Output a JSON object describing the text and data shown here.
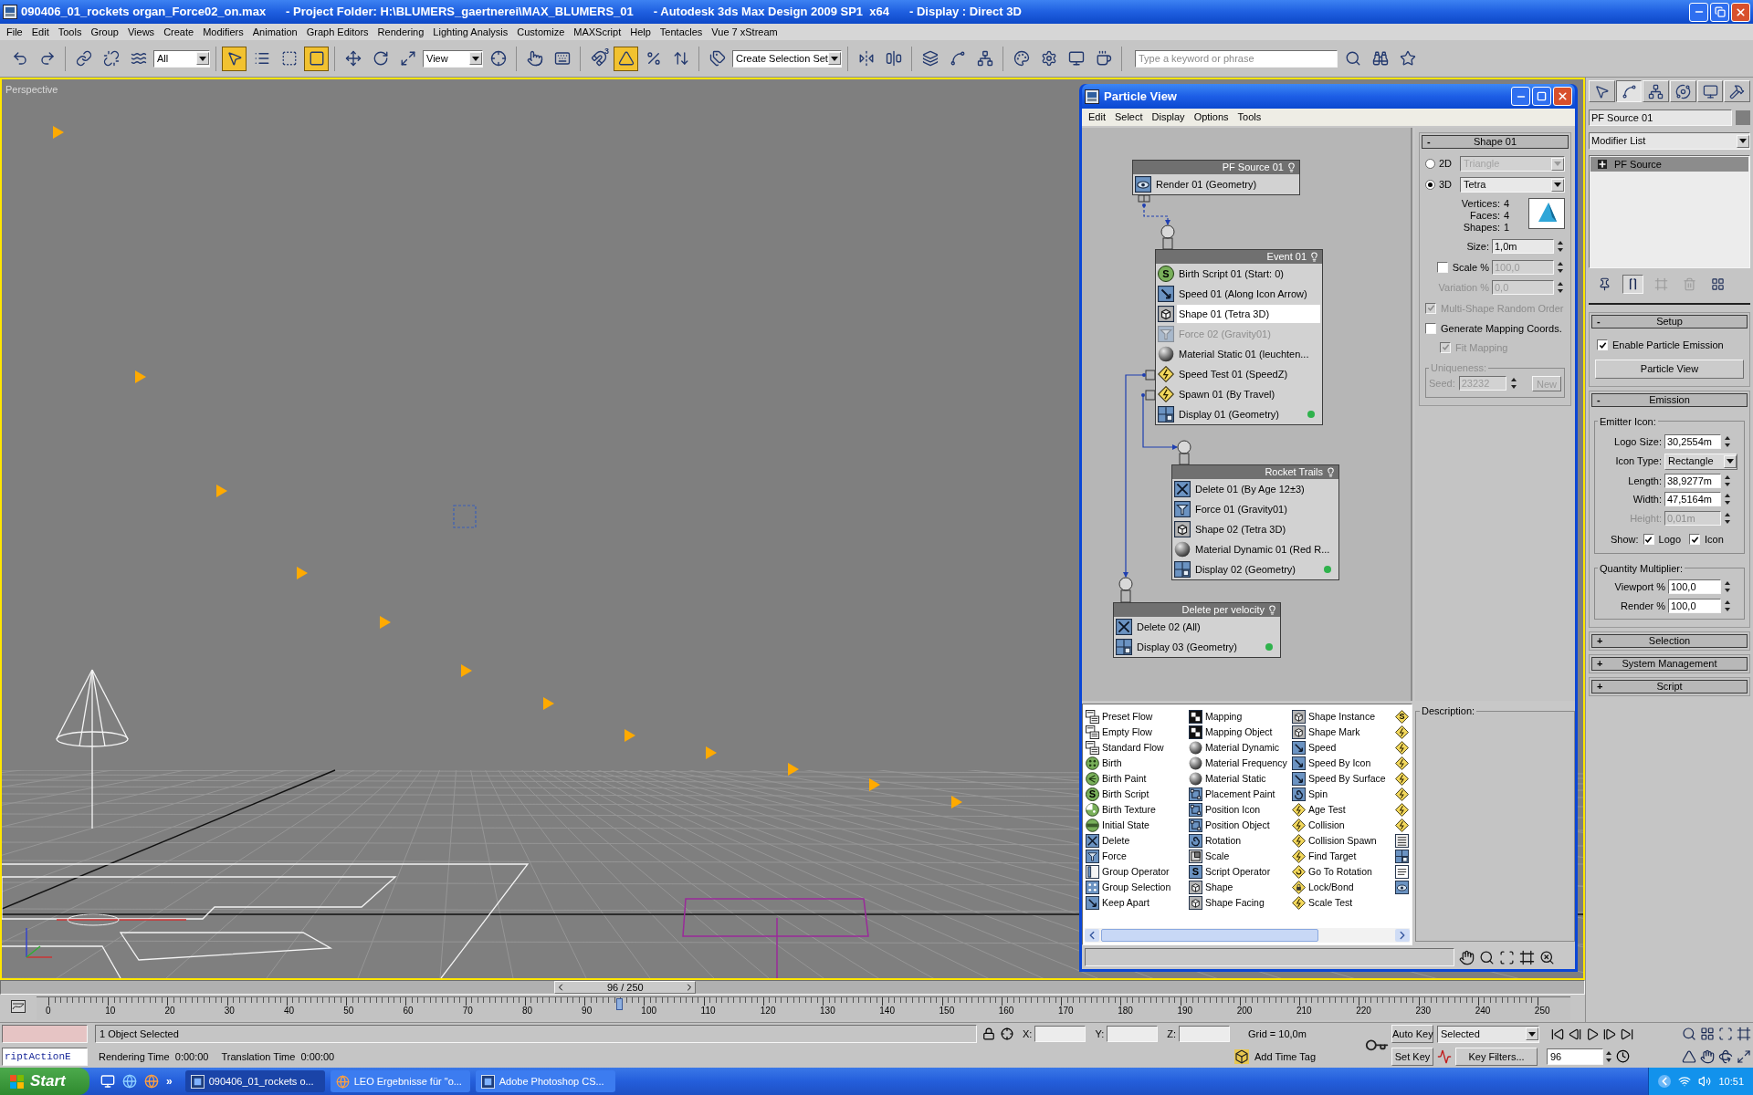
{
  "title_bar": {
    "segments": [
      "090406_01_rockets organ_Force02_on.max",
      "- Project Folder: H:\\BLUMERS_gaertnerei\\MAX_BLUMERS_01",
      "- Autodesk 3ds Max Design 2009 SP1  x64",
      "- Display : Direct 3D"
    ]
  },
  "menu": [
    "File",
    "Edit",
    "Tools",
    "Group",
    "Views",
    "Create",
    "Modifiers",
    "Animation",
    "Graph Editors",
    "Rendering",
    "Lighting Analysis",
    "Customize",
    "MAXScript",
    "Help",
    "Tentacles",
    "Vue 7 xStream"
  ],
  "toolbar": {
    "groups": [
      [
        {
          "kind": "button",
          "selected": false
        },
        {
          "kind": "button",
          "selected": false
        }
      ],
      [
        {
          "kind": "button",
          "selected": false
        },
        {
          "kind": "button",
          "selected": false
        },
        {
          "kind": "button",
          "selected": false
        },
        {
          "kind": "dropdown",
          "value": "All"
        }
      ],
      [
        {
          "kind": "button",
          "selected": true
        },
        {
          "kind": "button",
          "selected": false
        },
        {
          "kind": "button",
          "selected": false
        },
        {
          "kind": "button",
          "selected": true
        }
      ],
      [
        {
          "kind": "button",
          "selected": false
        },
        {
          "kind": "button",
          "selected": false
        },
        {
          "kind": "button",
          "selected": false
        },
        {
          "kind": "dropdown",
          "value": "View"
        },
        {
          "kind": "button",
          "selected": false
        }
      ],
      [
        {
          "kind": "button",
          "selected": false
        },
        {
          "kind": "button",
          "selected": false
        }
      ],
      [
        {
          "kind": "button",
          "selected": false,
          "badge": "3"
        },
        {
          "kind": "button",
          "selected": true
        },
        {
          "kind": "button",
          "selected": false
        },
        {
          "kind": "button",
          "selected": false
        }
      ],
      [
        {
          "kind": "button",
          "selected": false
        },
        {
          "kind": "dropdown",
          "value": "Create Selection Set"
        }
      ],
      [
        {
          "kind": "button",
          "selected": false
        },
        {
          "kind": "button",
          "selected": false
        }
      ],
      [
        {
          "kind": "button",
          "selected": false
        },
        {
          "kind": "button",
          "selected": false
        },
        {
          "kind": "button",
          "selected": false
        }
      ],
      [
        {
          "kind": "button",
          "selected": false
        },
        {
          "kind": "button",
          "selected": false
        },
        {
          "kind": "button",
          "selected": false
        },
        {
          "kind": "button",
          "selected": false
        }
      ],
      [
        {
          "kind": "search",
          "placeholder": "Type a keyword or phrase"
        },
        {
          "kind": "button",
          "selected": false
        },
        {
          "kind": "button",
          "selected": false
        },
        {
          "kind": "button",
          "selected": false
        }
      ]
    ]
  },
  "viewport": {
    "label": "Perspective",
    "active": true
  },
  "particle_view": {
    "title": "Particle View",
    "menu": [
      "Edit",
      "Select",
      "Display",
      "Options",
      "Tools"
    ],
    "nodes": [
      {
        "title": "PF Source 01",
        "rows": [
          {
            "label": "Render 01 (Geometry)",
            "kind": "render",
            "selected": false,
            "disabled": false
          }
        ]
      },
      {
        "title": "Event 01",
        "rows": [
          {
            "label": "Birth Script 01 (Start: 0)",
            "kind": "birth_script",
            "glyph": "S",
            "selected": false,
            "disabled": false
          },
          {
            "label": "Speed 01 (Along Icon Arrow)",
            "kind": "speed",
            "selected": false,
            "disabled": false
          },
          {
            "label": "Shape 01 (Tetra 3D)",
            "kind": "shape",
            "selected": true,
            "disabled": false
          },
          {
            "label": "Force 02 (Gravity01)",
            "kind": "force",
            "selected": false,
            "disabled": true
          },
          {
            "label": "Material Static 01 (leuchten...",
            "kind": "material",
            "selected": false,
            "disabled": false
          },
          {
            "label": "Speed Test 01 (SpeedZ)",
            "kind": "test",
            "selected": false,
            "disabled": false
          },
          {
            "label": "Spawn 01 (By Travel)",
            "kind": "test",
            "selected": false,
            "disabled": false
          },
          {
            "label": "Display 01 (Geometry)",
            "kind": "display",
            "color": "#2fb24c",
            "selected": false,
            "disabled": false
          }
        ]
      },
      {
        "title": "Rocket Trails",
        "rows": [
          {
            "label": "Delete 01 (By Age 12±3)",
            "kind": "delete",
            "selected": false,
            "disabled": false
          },
          {
            "label": "Force 01 (Gravity01)",
            "kind": "force",
            "selected": false,
            "disabled": false
          },
          {
            "label": "Shape 02 (Tetra 3D)",
            "kind": "shape",
            "selected": false,
            "disabled": false
          },
          {
            "label": "Material Dynamic 01 (Red R...",
            "kind": "material",
            "selected": false,
            "disabled": false
          },
          {
            "label": "Display 02 (Geometry)",
            "kind": "display",
            "color": "#2fb24c",
            "selected": false,
            "disabled": false
          }
        ]
      },
      {
        "title": "Delete per velocity",
        "rows": [
          {
            "label": "Delete 02 (All)",
            "kind": "delete",
            "selected": false,
            "disabled": false
          },
          {
            "label": "Display 03 (Geometry)",
            "kind": "display",
            "color": "#2fb24c",
            "selected": false,
            "disabled": false
          }
        ]
      }
    ],
    "params": {
      "sign": "-",
      "title": "Shape 01",
      "modes": [
        {
          "label": "2D",
          "selected": false,
          "value": "Triangle",
          "disabled": true
        },
        {
          "label": "3D",
          "selected": true,
          "value": "Tetra",
          "disabled": false
        }
      ],
      "stats": [
        {
          "label": "Vertices:",
          "value": "4"
        },
        {
          "label": "Faces:",
          "value": "4"
        },
        {
          "label": "Shapes:",
          "value": "1"
        }
      ],
      "fields": [
        {
          "kind": "spinner",
          "label": "Size:",
          "value": "1,0m",
          "disabled": false
        },
        {
          "kind": "check_spinner",
          "label": "Scale %",
          "checked": false,
          "value": "100,0",
          "disabled": true
        },
        {
          "kind": "spinner",
          "label": "Variation %",
          "value": "0,0",
          "disabled": true
        }
      ],
      "options": [
        {
          "label": "Multi-Shape Random Order",
          "checked": true,
          "disabled": true
        },
        {
          "label": "Generate Mapping Coords.",
          "checked": false,
          "disabled": false,
          "children": [
            {
              "label": "Fit Mapping",
              "checked": true,
              "disabled": true
            }
          ]
        }
      ],
      "uniqueness": {
        "title": "Uniqueness:",
        "seed_label": "Seed:",
        "seed": "23232",
        "button": "New",
        "disabled": true
      }
    },
    "depot": {
      "columns": [
        [
          {
            "label": "Preset Flow",
            "kind": "flow"
          },
          {
            "label": "Empty Flow",
            "kind": "flow"
          },
          {
            "label": "Standard Flow",
            "kind": "flow"
          },
          {
            "label": "Birth",
            "kind": "birth"
          },
          {
            "label": "Birth Paint",
            "kind": "birth_paint"
          },
          {
            "label": "Birth Script",
            "kind": "birth_script",
            "glyph": "S"
          },
          {
            "label": "Birth Texture",
            "kind": "birth_texture"
          },
          {
            "label": "Initial State",
            "kind": "initial_state"
          },
          {
            "label": "Delete",
            "kind": "delete"
          },
          {
            "label": "Force",
            "kind": "force"
          },
          {
            "label": "Group Operator",
            "kind": "group"
          },
          {
            "label": "Group Selection",
            "kind": "group_selection"
          },
          {
            "label": "Keep Apart",
            "kind": "speed"
          }
        ],
        [
          {
            "label": "Mapping",
            "kind": "mapping"
          },
          {
            "label": "Mapping Object",
            "kind": "mapping"
          },
          {
            "label": "Material Dynamic",
            "kind": "material"
          },
          {
            "label": "Material Frequency",
            "kind": "material"
          },
          {
            "label": "Material Static",
            "kind": "material"
          },
          {
            "label": "Placement Paint",
            "kind": "position"
          },
          {
            "label": "Position Icon",
            "kind": "position"
          },
          {
            "label": "Position Object",
            "kind": "position"
          },
          {
            "label": "Rotation",
            "kind": "rotation"
          },
          {
            "label": "Scale",
            "kind": "scale"
          },
          {
            "label": "Script Operator",
            "kind": "script",
            "glyph": "S"
          },
          {
            "label": "Shape",
            "kind": "shape"
          },
          {
            "label": "Shape Facing",
            "kind": "shape"
          }
        ],
        [
          {
            "label": "Shape Instance",
            "kind": "shape"
          },
          {
            "label": "Shape Mark",
            "kind": "shape"
          },
          {
            "label": "Speed",
            "kind": "speed"
          },
          {
            "label": "Speed By Icon",
            "kind": "speed"
          },
          {
            "label": "Speed By Surface",
            "kind": "speed"
          },
          {
            "label": "Spin",
            "kind": "rotation"
          },
          {
            "label": "Age Test",
            "kind": "test"
          },
          {
            "label": "Collision",
            "kind": "test"
          },
          {
            "label": "Collision Spawn",
            "kind": "test"
          },
          {
            "label": "Find Target",
            "kind": "test"
          },
          {
            "label": "Go To Rotation",
            "kind": "test_rotation"
          },
          {
            "label": "Lock/Bond",
            "kind": "test_lock"
          },
          {
            "label": "Scale Test",
            "kind": "test"
          }
        ],
        [
          {
            "kind": "test_script",
            "glyph": "S"
          },
          {
            "kind": "test"
          },
          {
            "kind": "test"
          },
          {
            "kind": "test"
          },
          {
            "kind": "test"
          },
          {
            "kind": "test"
          },
          {
            "kind": "test"
          },
          {
            "kind": "test"
          },
          {
            "kind": "cache"
          },
          {
            "kind": "display"
          },
          {
            "kind": "notes"
          },
          {
            "kind": "render"
          }
        ]
      ]
    },
    "description": {
      "label": "Description:"
    }
  },
  "command_panel": {
    "tabs": [
      {
        "selected": false
      },
      {
        "selected": true
      },
      {
        "selected": false
      },
      {
        "selected": false
      },
      {
        "selected": false
      },
      {
        "selected": false
      }
    ],
    "object": {
      "name": "PF Source 01",
      "color": "#7f7f7f"
    },
    "modifier_list": "Modifier List",
    "stack": [
      {
        "label": "PF Source",
        "selected": true
      }
    ],
    "stack_tools": [
      {
        "selected": false,
        "disabled": false
      },
      {
        "selected": true,
        "disabled": false
      },
      {
        "selected": false,
        "disabled": true
      },
      {
        "selected": false,
        "disabled": true
      },
      {
        "selected": false,
        "disabled": false
      }
    ],
    "rollouts": [
      {
        "kind": "setup",
        "title": "Setup",
        "sign": "-",
        "checkbox": {
          "label": "Enable Particle Emission",
          "checked": true
        },
        "button": "Particle View"
      },
      {
        "kind": "emission",
        "title": "Emission",
        "sign": "-",
        "icon_group": "Emitter Icon:",
        "fields": [
          {
            "kind": "spinner",
            "label": "Logo Size:",
            "value": "30,2554m",
            "disabled": false
          },
          {
            "kind": "dropdown",
            "label": "Icon Type:",
            "value": "Rectangle",
            "disabled": false
          },
          {
            "kind": "spinner",
            "label": "Length:",
            "value": "38,9277m",
            "disabled": false
          },
          {
            "kind": "spinner",
            "label": "Width:",
            "value": "47,5164m",
            "disabled": false
          },
          {
            "kind": "spinner",
            "label": "Height:",
            "value": "0,01m",
            "disabled": true
          }
        ],
        "show": {
          "label": "Show:",
          "options": [
            {
              "label": "Logo",
              "checked": true
            },
            {
              "label": "Icon",
              "checked": true
            }
          ]
        },
        "quantity_group": "Quantity Multiplier:",
        "quantity": [
          {
            "label": "Viewport %",
            "value": "100,0",
            "disabled": false
          },
          {
            "label": "Render %",
            "value": "100,0",
            "disabled": false
          }
        ]
      },
      {
        "kind": "collapsed",
        "title": "Selection",
        "sign": "+"
      },
      {
        "kind": "collapsed",
        "title": "System Management",
        "sign": "+"
      },
      {
        "kind": "collapsed",
        "title": "Script",
        "sign": "+"
      }
    ]
  },
  "timeline": {
    "slider": {
      "label": "96 / 250",
      "level": 0.384
    },
    "ruler": [
      "0",
      "10",
      "20",
      "30",
      "40",
      "50",
      "60",
      "70",
      "80",
      "90",
      "100",
      "110",
      "120",
      "130",
      "140",
      "150",
      "160",
      "170",
      "180",
      "190",
      "200",
      "210",
      "220",
      "230",
      "240",
      "250"
    ]
  },
  "status_bar": {
    "listener_output": "riptActionE",
    "selection": "1 Object Selected",
    "prompt": [
      "Rendering Time  0:00:00",
      "Translation Time  0:00:00"
    ],
    "coordinates": [
      {
        "label": "X:"
      },
      {
        "label": "Y:"
      },
      {
        "label": "Z:"
      }
    ],
    "grid": "Grid = 10,0m",
    "time_tag": "Add Time Tag",
    "auto_key": {
      "label": "Auto Key",
      "on": false
    },
    "set_key": "Set Key",
    "key_mode": "Selected",
    "key_filters": "Key Filters...",
    "frame": "96"
  },
  "taskbar": {
    "start": "Start",
    "overflow": "»",
    "tasks": [
      {
        "label": "090406_01_rockets o...",
        "selected": true
      },
      {
        "label": "LEO Ergebnisse für \"o...",
        "selected": false
      },
      {
        "label": "Adobe Photoshop CS...",
        "selected": false
      }
    ],
    "clock": "10:51"
  }
}
